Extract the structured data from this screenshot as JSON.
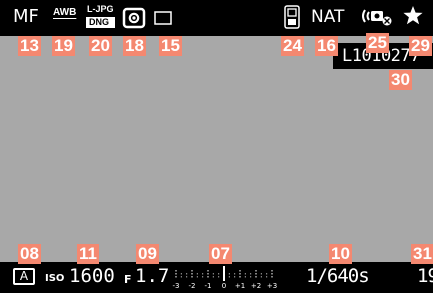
{
  "top": {
    "focus_mode": "MF",
    "white_balance": "AWB",
    "file_format": [
      "L-JPG",
      "DNG"
    ],
    "metering_icon": "spot-metering-icon",
    "frame_icon": "aspect-frame-icon",
    "hdr_icon": "hdr-icon",
    "film_style": "NAT",
    "stabilization_icon": "image-stabilization-off-icon",
    "favorite_icon": "star-icon"
  },
  "file_name": "L1010277",
  "bottom": {
    "exposure_mode": "A",
    "iso_label": "ISO",
    "iso_value": "1600",
    "aperture_prefix": "F",
    "aperture_value": "1.7",
    "scale_labels": [
      "-3",
      "-2",
      "-1",
      "0",
      "+1",
      "+2",
      "+3"
    ],
    "shutter_value": "1/640s",
    "shots_remaining": "19"
  },
  "callouts": [
    "13",
    "19",
    "20",
    "18",
    "15",
    "24",
    "16",
    "25",
    "29",
    "30",
    "08",
    "11",
    "09",
    "07",
    "10",
    "31"
  ],
  "colors": {
    "callout_bg": "#f48870",
    "bar_bg": "#000000",
    "screen_bg": "#a8a8a8"
  }
}
